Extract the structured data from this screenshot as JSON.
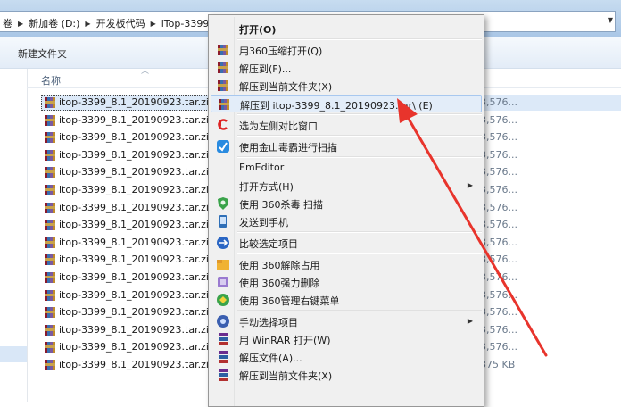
{
  "address_bar": {
    "crumbs": [
      "卷",
      "新加卷 (D:)",
      "开发板代码",
      "iTop-3399"
    ]
  },
  "toolbar": {
    "new_folder": "新建文件夹"
  },
  "list": {
    "name_header": "名称",
    "files": [
      {
        "name": "itop-3399_8.1_20190923.tar.zip",
        "size": "3,576...",
        "selected": true
      },
      {
        "name": "itop-3399_8.1_20190923.tar.zip",
        "size": "3,576..."
      },
      {
        "name": "itop-3399_8.1_20190923.tar.zip",
        "size": "3,576..."
      },
      {
        "name": "itop-3399_8.1_20190923.tar.zip",
        "size": "3,576..."
      },
      {
        "name": "itop-3399_8.1_20190923.tar.zip",
        "size": "3,576..."
      },
      {
        "name": "itop-3399_8.1_20190923.tar.zip",
        "size": "3,576..."
      },
      {
        "name": "itop-3399_8.1_20190923.tar.zip",
        "size": "3,576..."
      },
      {
        "name": "itop-3399_8.1_20190923.tar.zip",
        "size": "3,576..."
      },
      {
        "name": "itop-3399_8.1_20190923.tar.zip",
        "size": "3,576..."
      },
      {
        "name": "itop-3399_8.1_20190923.tar.zip",
        "size": "3,576..."
      },
      {
        "name": "itop-3399_8.1_20190923.tar.zip",
        "size": "3,576..."
      },
      {
        "name": "itop-3399_8.1_20190923.tar.zip",
        "size": "3,576..."
      },
      {
        "name": "itop-3399_8.1_20190923.tar.zip",
        "size": "3,576..."
      },
      {
        "name": "itop-3399_8.1_20190923.tar.zip",
        "size": "3,576..."
      },
      {
        "name": "itop-3399_8.1_20190923.tar.zip",
        "size": "3,576..."
      },
      {
        "name": "itop-3399_8.1_20190923.tar.zip",
        "size": "375 KB"
      }
    ]
  },
  "context_menu": {
    "items": [
      {
        "label": "打开(O)",
        "icon": "none",
        "bold": true
      },
      {
        "separator": true
      },
      {
        "label": "用360压缩打开(Q)",
        "icon": "archive-icon"
      },
      {
        "label": "解压到(F)...",
        "icon": "archive-icon"
      },
      {
        "label": "解压到当前文件夹(X)",
        "icon": "archive-icon"
      },
      {
        "label": "解压到 itop-3399_8.1_20190923.tar\\ (E)",
        "icon": "archive-icon",
        "highlighted": true
      },
      {
        "separator": true
      },
      {
        "label": "选为左侧对比窗口",
        "icon": "compare-arrow-icon"
      },
      {
        "separator": true
      },
      {
        "label": "使用金山毒霸进行扫描",
        "icon": "shield-scan-icon"
      },
      {
        "separator": true
      },
      {
        "label": "EmEditor",
        "icon": "none"
      },
      {
        "label": "打开方式(H)",
        "icon": "none",
        "submenu": true
      },
      {
        "label": "使用 360杀毒 扫描",
        "icon": "antivirus-icon"
      },
      {
        "label": "发送到手机",
        "icon": "phone-icon"
      },
      {
        "separator": true
      },
      {
        "label": "比较选定项目",
        "icon": "compare-icon"
      },
      {
        "separator": true
      },
      {
        "label": "使用 360解除占用",
        "icon": "unlock-icon"
      },
      {
        "label": "使用 360强力删除",
        "icon": "delete-icon"
      },
      {
        "label": "使用 360管理右键菜单",
        "icon": "menu-manage-icon"
      },
      {
        "separator": true
      },
      {
        "label": "手动选择项目",
        "icon": "select-icon",
        "submenu": true
      },
      {
        "label": "用 WinRAR 打开(W)",
        "icon": "winrar-icon"
      },
      {
        "label": "解压文件(A)...",
        "icon": "winrar-icon"
      },
      {
        "label": "解压到当前文件夹(X)",
        "icon": "winrar-icon"
      }
    ]
  },
  "colors": {
    "annotation_arrow": "#e8342c",
    "highlight": "#e3edf9",
    "selection": "#dce9f8"
  }
}
